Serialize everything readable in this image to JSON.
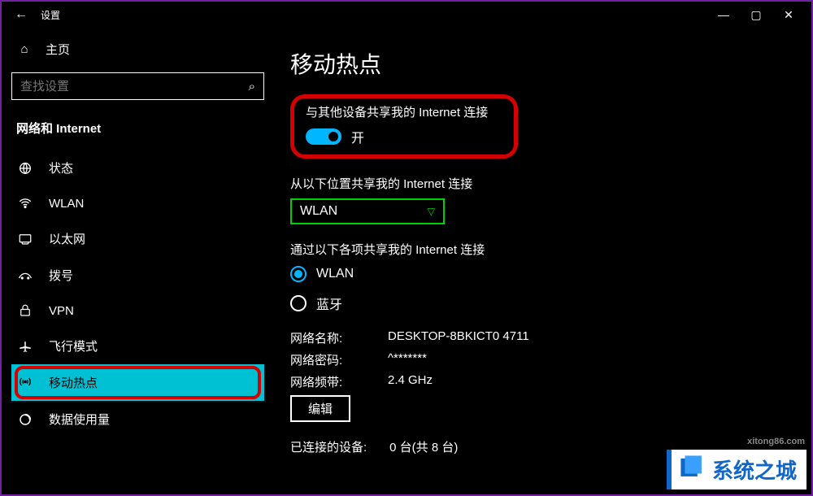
{
  "titlebar": {
    "back_glyph": "←",
    "title": "设置"
  },
  "sidebar": {
    "home": "主页",
    "search_placeholder": "查找设置",
    "section": "网络和 Internet",
    "items": [
      {
        "id": "status",
        "label": "状态"
      },
      {
        "id": "wlan",
        "label": "WLAN"
      },
      {
        "id": "ethernet",
        "label": "以太网"
      },
      {
        "id": "dialup",
        "label": "拨号"
      },
      {
        "id": "vpn",
        "label": "VPN"
      },
      {
        "id": "airplane",
        "label": "飞行模式"
      },
      {
        "id": "hotspot",
        "label": "移动热点",
        "selected": true
      },
      {
        "id": "datausage",
        "label": "数据使用量"
      }
    ]
  },
  "main": {
    "title": "移动热点",
    "share_label": "与其他设备共享我的 Internet 连接",
    "toggle_state": "开",
    "share_from_label": "从以下位置共享我的 Internet 连接",
    "share_from_value": "WLAN",
    "share_via_label": "通过以下各项共享我的 Internet 连接",
    "radio_wlan": "WLAN",
    "radio_bt": "蓝牙",
    "net_name_label": "网络名称:",
    "net_name_value": "DESKTOP-8BKICT0 4711",
    "net_pwd_label": "网络密码:",
    "net_pwd_value": "^*******",
    "net_band_label": "网络频带:",
    "net_band_value": "2.4 GHz",
    "edit": "编辑",
    "devices_label": "已连接的设备:",
    "devices_value": "0 台(共 8 台)"
  },
  "watermark": {
    "text": "系统之城",
    "url": "xitong86.com"
  }
}
